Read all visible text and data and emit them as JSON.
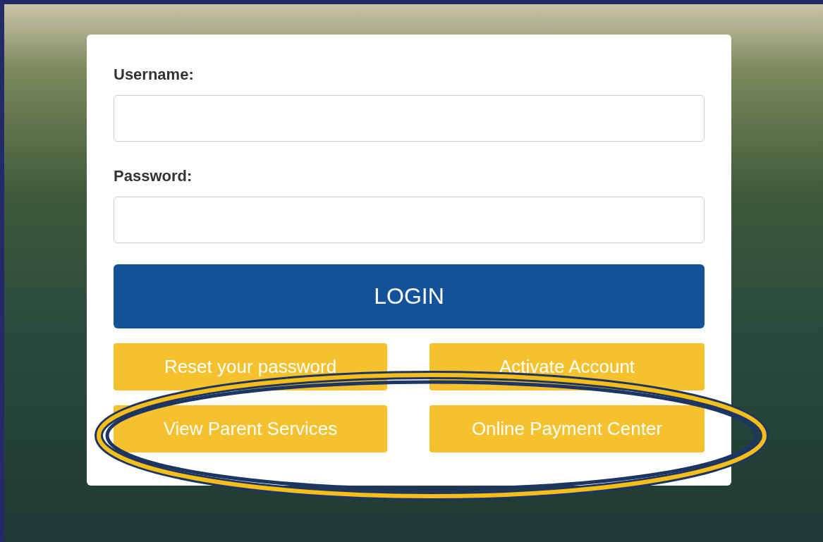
{
  "login_form": {
    "fields": [
      {
        "label": "Username:"
      },
      {
        "label": "Password:"
      }
    ],
    "submit": "LOGIN",
    "links": [
      "Reset your password",
      "Activate Account",
      "View Parent Services",
      "Online Payment Center"
    ]
  },
  "annotation": {
    "kind": "ellipse"
  }
}
